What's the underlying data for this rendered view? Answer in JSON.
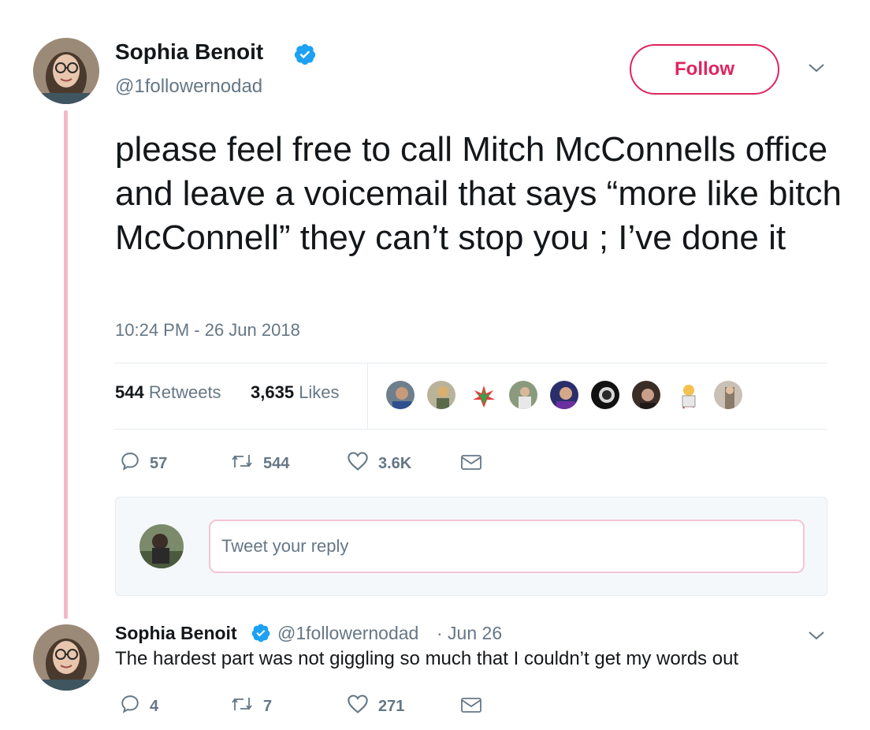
{
  "tweet": {
    "author_name": "Sophia Benoit",
    "author_handle": "@1followernodad",
    "follow_label": "Follow",
    "text": "please feel free to call Mitch McConnells office and leave a voicemail that says “more like bitch McConnell” they can’t stop you ; I’ve done it",
    "timestamp": "10:24 PM - 26 Jun 2018",
    "retweets_count": "544",
    "retweets_label": "Retweets",
    "likes_count": "3,635",
    "likes_label": "Likes",
    "actions": {
      "replies": "57",
      "retweets": "544",
      "likes": "3.6K"
    }
  },
  "reply_box": {
    "placeholder": "Tweet your reply"
  },
  "reply": {
    "author_name": "Sophia Benoit",
    "author_handle": "@1followernodad",
    "date": "· Jun 26",
    "text": "The hardest part was not giggling so much that I couldn’t get my words out",
    "actions": {
      "replies": "4",
      "retweets": "7",
      "likes": "271"
    }
  },
  "icons": {
    "verified": "verified-badge-icon",
    "chevron": "chevron-down-icon",
    "reply": "reply-icon",
    "retweet": "retweet-icon",
    "like": "heart-icon",
    "dm": "envelope-icon"
  },
  "colors": {
    "accent_pink": "#e0245e",
    "thread_line": "#f3b8c8",
    "verified_blue": "#1da1f2",
    "muted_text": "#657786"
  }
}
